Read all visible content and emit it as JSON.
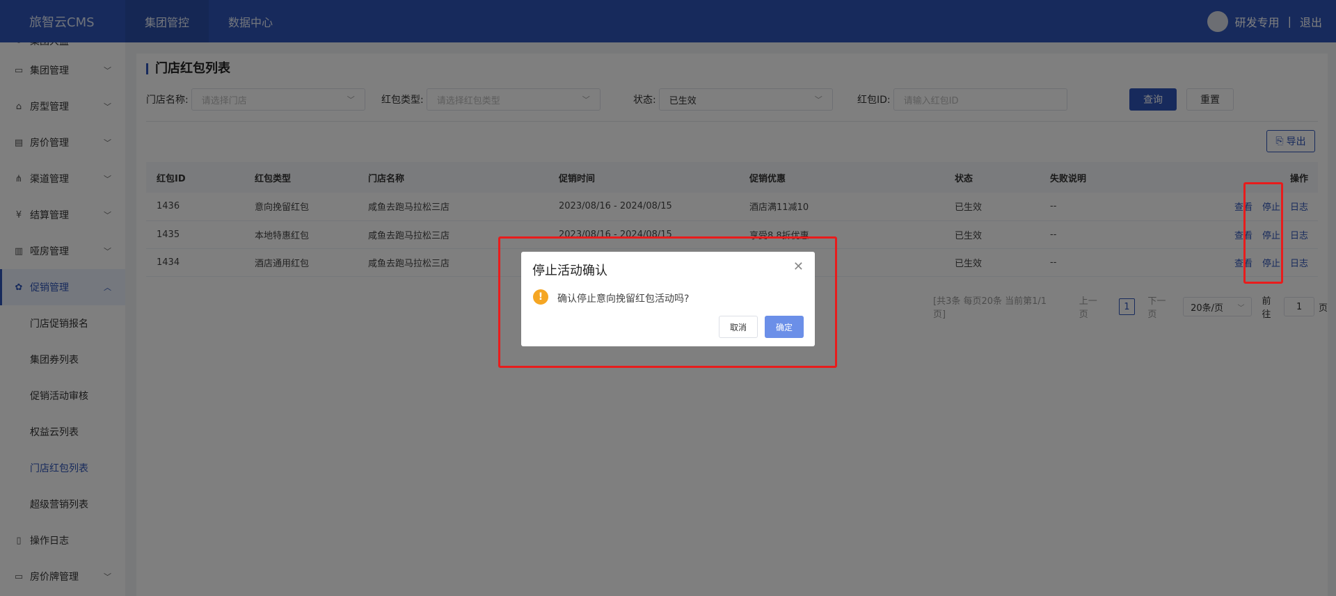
{
  "app": {
    "logo": "旅智云CMS",
    "nav_tabs": [
      "集团管控",
      "数据中心"
    ],
    "user_name": "研发专用",
    "separator": "|",
    "logout": "退出"
  },
  "sidebar": {
    "partial_item": "集团大盘",
    "items_top": [
      {
        "label": "集团管理",
        "icon": "message-icon"
      },
      {
        "label": "房型管理",
        "icon": "home-icon"
      },
      {
        "label": "房价管理",
        "icon": "card-icon"
      },
      {
        "label": "渠道管理",
        "icon": "network-icon"
      },
      {
        "label": "结算管理",
        "icon": "yen-icon"
      },
      {
        "label": "哑房管理",
        "icon": "report-icon"
      }
    ],
    "open_item": {
      "label": "促销管理",
      "icon": "promo-icon"
    },
    "sub_items": [
      "门店促销报名",
      "集团券列表",
      "促销活动审核",
      "权益云列表",
      "门店红包列表",
      "超级营销列表"
    ],
    "active_sub": "门店红包列表",
    "items_bottom": [
      {
        "label": "操作日志",
        "icon": "log-icon",
        "chevron": false
      },
      {
        "label": "房价牌管理",
        "icon": "board-icon",
        "chevron": true
      }
    ]
  },
  "page": {
    "title": "门店红包列表",
    "filters": {
      "store_label": "门店名称:",
      "store_placeholder": "请选择门店",
      "type_label": "红包类型:",
      "type_placeholder": "请选择红包类型",
      "status_label": "状态:",
      "status_value": "已生效",
      "id_label": "红包ID:",
      "id_placeholder": "请输入红包ID",
      "query": "查询",
      "reset": "重置"
    },
    "export": "导出",
    "table": {
      "headers": [
        "红包ID",
        "红包类型",
        "门店名称",
        "促销时间",
        "促销优惠",
        "状态",
        "失败说明",
        "操作"
      ],
      "rows": [
        {
          "id": "1436",
          "type": "意向挽留红包",
          "store": "咸鱼去跑马拉松三店",
          "time": "2023/08/16 - 2024/08/15",
          "offer": "酒店满11减10",
          "status": "已生效",
          "reason": "--"
        },
        {
          "id": "1435",
          "type": "本地特惠红包",
          "store": "咸鱼去跑马拉松三店",
          "time": "2023/08/16 - 2024/08/15",
          "offer": "享受8.8折优惠",
          "status": "已生效",
          "reason": "--"
        },
        {
          "id": "1434",
          "type": "酒店通用红包",
          "store": "咸鱼去跑马拉松三店",
          "time": "",
          "offer": "",
          "status": "已生效",
          "reason": "--"
        }
      ],
      "ops": {
        "view": "查看",
        "stop": "停止",
        "log": "日志"
      }
    },
    "pager": {
      "summary": "[共3条 每页20条 当前第1/1页]",
      "prev": "上一页",
      "current": "1",
      "next": "下一页",
      "page_size": "20条/页",
      "goto_label": "前往",
      "goto_value": "1",
      "page_suffix": "页"
    }
  },
  "dialog": {
    "title": "停止活动确认",
    "message": "确认停止意向挽留红包活动吗?",
    "cancel": "取消",
    "confirm": "确定",
    "warn_glyph": "!"
  },
  "colors": {
    "primary": "#2e55b8",
    "highlight": "#e81c1c",
    "warning": "#f5a623"
  }
}
